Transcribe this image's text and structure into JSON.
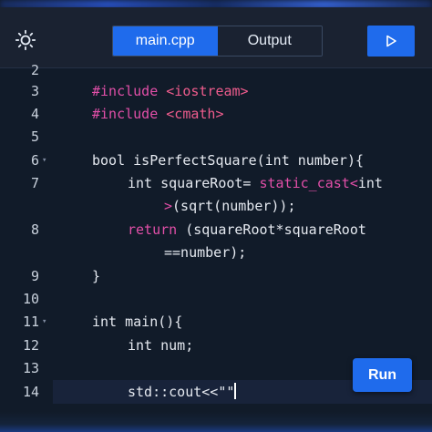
{
  "toolbar": {
    "theme_icon": "sun-icon",
    "tabs": [
      {
        "label": "main.cpp",
        "active": true
      },
      {
        "label": "Output",
        "active": false
      }
    ],
    "play_icon": "play-icon"
  },
  "colors": {
    "accent": "#1f6bec",
    "background": "#111b29",
    "toolbar_bg": "#1a2231",
    "directive": "#e24fa8",
    "include_target": "#ef5c8d"
  },
  "editor": {
    "lines": [
      {
        "num": "2",
        "fold": false
      },
      {
        "num": "3",
        "fold": false,
        "directive": "#include",
        "target": "<iostream>"
      },
      {
        "num": "4",
        "fold": false,
        "directive": "#include",
        "target": "<cmath>"
      },
      {
        "num": "5",
        "fold": false
      },
      {
        "num": "6",
        "fold": true,
        "text": "bool isPerfectSquare(int number){"
      },
      {
        "num": "7",
        "fold": false,
        "text_a": "int squareRoot= ",
        "cast": "static_cast<",
        "text_b": "int"
      },
      {
        "num": "",
        "fold": false,
        "cast_close": ">",
        "text": "(sqrt(number));"
      },
      {
        "num": "8",
        "fold": false,
        "ret": "return",
        "text": " (squareRoot*squareRoot"
      },
      {
        "num": "",
        "fold": false,
        "text": "==number);"
      },
      {
        "num": "9",
        "fold": false,
        "text": "}"
      },
      {
        "num": "10",
        "fold": false
      },
      {
        "num": "11",
        "fold": true,
        "text": "int main(){"
      },
      {
        "num": "12",
        "fold": false,
        "text": "int num;"
      },
      {
        "num": "13",
        "fold": false
      },
      {
        "num": "14",
        "fold": false,
        "text": "std::cout<<\"\""
      }
    ]
  },
  "run_button": {
    "label": "Run"
  }
}
